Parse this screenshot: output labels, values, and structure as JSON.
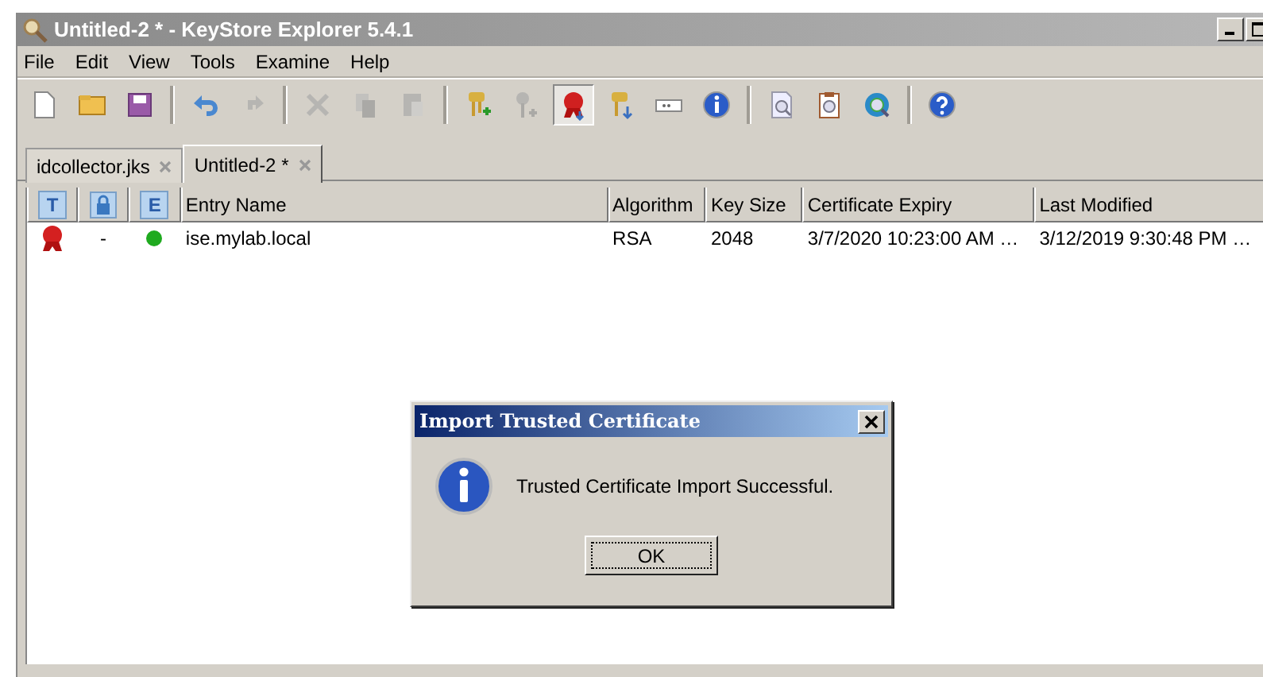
{
  "window": {
    "title": "Untitled-2 * - KeyStore Explorer 5.4.1"
  },
  "menu": [
    "File",
    "Edit",
    "View",
    "Tools",
    "Examine",
    "Help"
  ],
  "toolbar": [
    {
      "kind": "new",
      "disabled": false,
      "pressed": false
    },
    {
      "kind": "open",
      "disabled": false,
      "pressed": false
    },
    {
      "kind": "save",
      "disabled": false,
      "pressed": false
    },
    {
      "kind": "separator"
    },
    {
      "kind": "undo",
      "disabled": false,
      "pressed": false
    },
    {
      "kind": "redo",
      "disabled": true,
      "pressed": false
    },
    {
      "kind": "separator"
    },
    {
      "kind": "cut",
      "disabled": true,
      "pressed": false
    },
    {
      "kind": "copy",
      "disabled": true,
      "pressed": false
    },
    {
      "kind": "paste",
      "disabled": true,
      "pressed": false
    },
    {
      "kind": "separator"
    },
    {
      "kind": "keypair",
      "disabled": false,
      "pressed": false
    },
    {
      "kind": "secretkey",
      "disabled": true,
      "pressed": false
    },
    {
      "kind": "certificate",
      "disabled": false,
      "pressed": true
    },
    {
      "kind": "importkey",
      "disabled": false,
      "pressed": false
    },
    {
      "kind": "password",
      "disabled": false,
      "pressed": false
    },
    {
      "kind": "info",
      "disabled": false,
      "pressed": false
    },
    {
      "kind": "separator"
    },
    {
      "kind": "examinefile",
      "disabled": false,
      "pressed": false
    },
    {
      "kind": "examineclipboard",
      "disabled": false,
      "pressed": false
    },
    {
      "kind": "examinessl",
      "disabled": false,
      "pressed": false
    },
    {
      "kind": "separator"
    },
    {
      "kind": "help",
      "disabled": false,
      "pressed": false
    }
  ],
  "tabs": [
    {
      "label": "idcollector.jks",
      "selected": false
    },
    {
      "label": "Untitled-2 *",
      "selected": true
    }
  ],
  "table": {
    "columns": [
      {
        "kind": "letter",
        "label": "T"
      },
      {
        "kind": "lock"
      },
      {
        "kind": "letter",
        "label": "E"
      },
      {
        "kind": "text",
        "label": "Entry Name"
      },
      {
        "kind": "text",
        "label": "Algorithm"
      },
      {
        "kind": "text",
        "label": "Key Size"
      },
      {
        "kind": "text",
        "label": "Certificate Expiry"
      },
      {
        "kind": "text",
        "label": "Last Modified"
      }
    ],
    "rows": [
      {
        "kind": "certificate",
        "lock": "-",
        "color": "#1faa1f",
        "entry_name": "ise.mylab.local",
        "algorithm": "RSA",
        "key_size": "2048",
        "certificate_expiry": "3/7/2020 10:23:00 AM …",
        "last_modified": "3/12/2019 9:30:48 PM …"
      }
    ]
  },
  "dialog": {
    "title": "Import Trusted Certificate",
    "message": "Trusted Certificate Import Successful.",
    "button": "OK"
  }
}
